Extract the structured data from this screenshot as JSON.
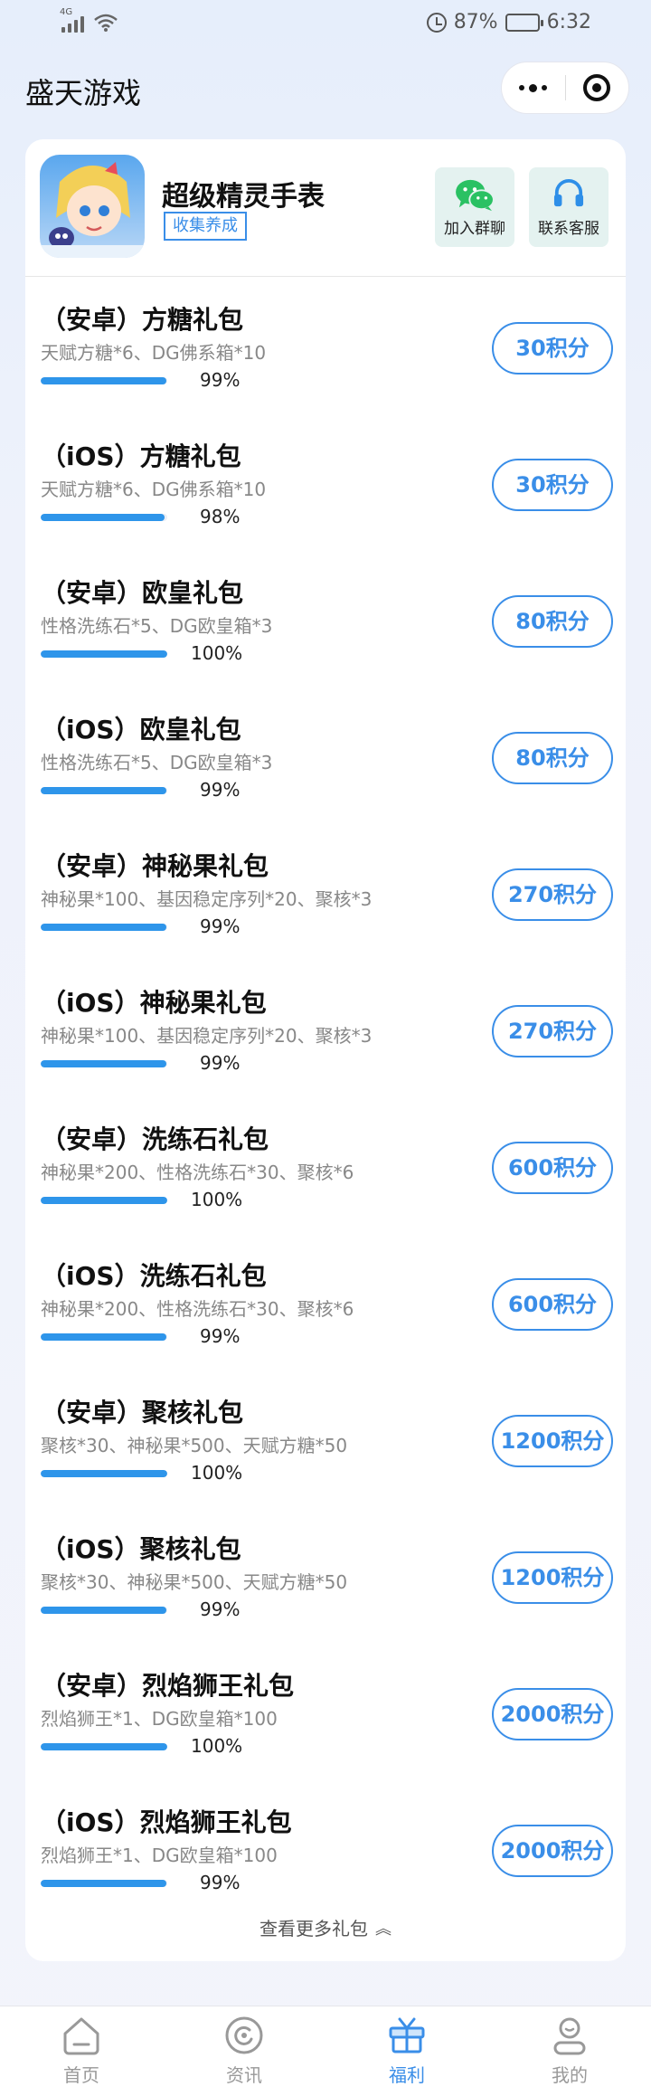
{
  "status_bar": {
    "network": "4G",
    "battery": "87%",
    "time": "6:32",
    "battery_level": 0.87
  },
  "header": {
    "title": "盛天游戏"
  },
  "game": {
    "name": "超级精灵手表",
    "tag": "收集养成",
    "join_group": "加入群聊",
    "contact_service": "联系客服"
  },
  "packages": [
    {
      "name": "（安卓）方糖礼包",
      "desc": "天赋方糖*6、DG佛系箱*10",
      "progress": 0.99,
      "percent_label": "99%",
      "price": "30积分"
    },
    {
      "name": "（iOS）方糖礼包",
      "desc": "天赋方糖*6、DG佛系箱*10",
      "progress": 0.98,
      "percent_label": "98%",
      "price": "30积分"
    },
    {
      "name": "（安卓）欧皇礼包",
      "desc": "性格洗练石*5、DG欧皇箱*3",
      "progress": 1.0,
      "percent_label": "100%",
      "price": "80积分"
    },
    {
      "name": "（iOS）欧皇礼包",
      "desc": "性格洗练石*5、DG欧皇箱*3",
      "progress": 0.99,
      "percent_label": "99%",
      "price": "80积分"
    },
    {
      "name": "（安卓）神秘果礼包",
      "desc": "神秘果*100、基因稳定序列*20、聚核*3",
      "progress": 0.99,
      "percent_label": "99%",
      "price": "270积分"
    },
    {
      "name": "（iOS）神秘果礼包",
      "desc": "神秘果*100、基因稳定序列*20、聚核*3",
      "progress": 0.99,
      "percent_label": "99%",
      "price": "270积分"
    },
    {
      "name": "（安卓）洗练石礼包",
      "desc": "神秘果*200、性格洗练石*30、聚核*6",
      "progress": 1.0,
      "percent_label": "100%",
      "price": "600积分"
    },
    {
      "name": "（iOS）洗练石礼包",
      "desc": "神秘果*200、性格洗练石*30、聚核*6",
      "progress": 0.99,
      "percent_label": "99%",
      "price": "600积分"
    },
    {
      "name": "（安卓）聚核礼包",
      "desc": "聚核*30、神秘果*500、天赋方糖*50",
      "progress": 1.0,
      "percent_label": "100%",
      "price": "1200积分"
    },
    {
      "name": "（iOS）聚核礼包",
      "desc": "聚核*30、神秘果*500、天赋方糖*50",
      "progress": 0.99,
      "percent_label": "99%",
      "price": "1200积分"
    },
    {
      "name": "（安卓）烈焰狮王礼包",
      "desc": "烈焰狮王*1、DG欧皇箱*100",
      "progress": 1.0,
      "percent_label": "100%",
      "price": "2000积分"
    },
    {
      "name": "（iOS）烈焰狮王礼包",
      "desc": "烈焰狮王*1、DG欧皇箱*100",
      "progress": 0.99,
      "percent_label": "99%",
      "price": "2000积分"
    }
  ],
  "more_link": "查看更多礼包",
  "tabbar": [
    {
      "label": "首页",
      "icon": "home-icon",
      "active": false
    },
    {
      "label": "资讯",
      "icon": "news-icon",
      "active": false
    },
    {
      "label": "福利",
      "icon": "gift-icon",
      "active": true
    },
    {
      "label": "我的",
      "icon": "profile-icon",
      "active": false
    }
  ],
  "colors": {
    "accent": "#3a8ee8",
    "progress": "#2e95ea",
    "wechat_green": "#2ac163"
  }
}
